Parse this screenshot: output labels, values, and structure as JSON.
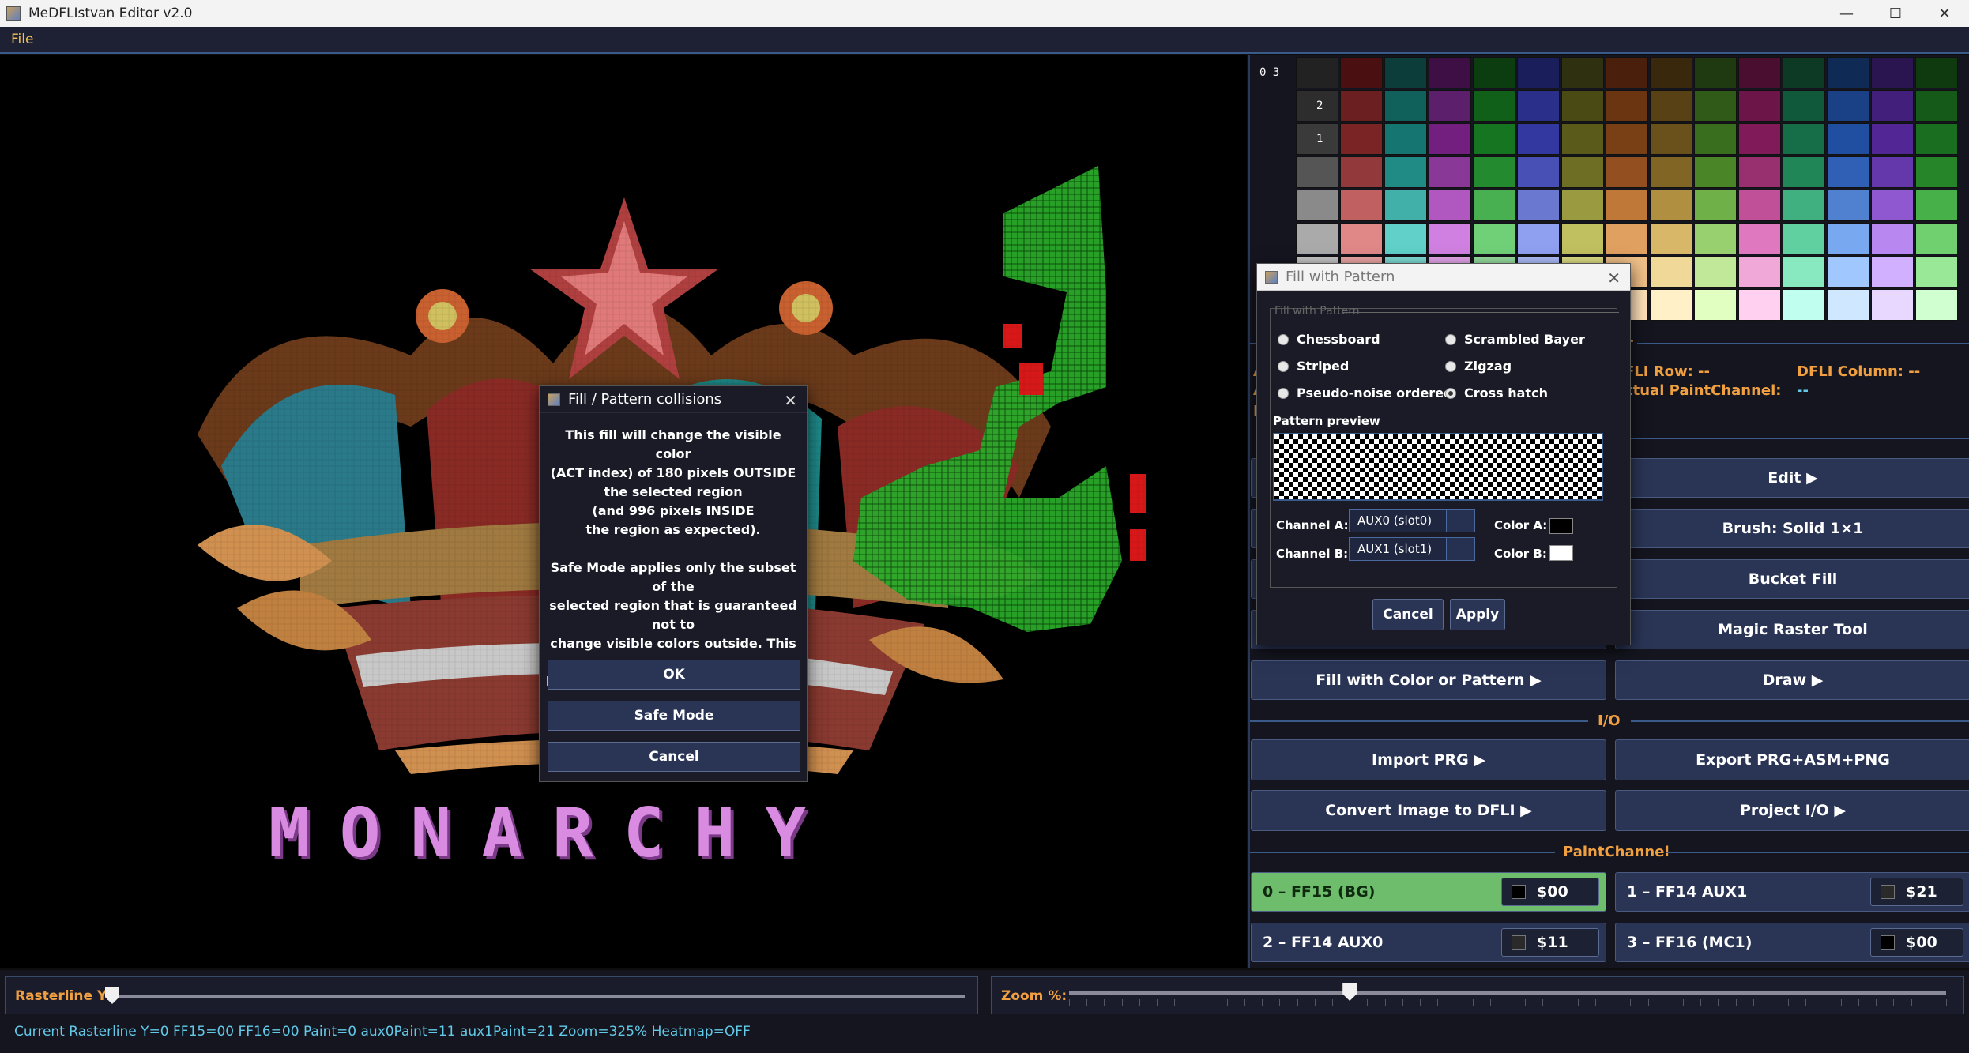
{
  "window": {
    "title": "MeDFLIstvan Editor v2.0",
    "minimize": "—",
    "maximize": "☐",
    "close": "✕"
  },
  "menu": {
    "file": "File"
  },
  "canvas": {
    "logo_text": "MONARCHY"
  },
  "palette": {
    "header_label": "0 3",
    "row_labels": [
      "2",
      "1"
    ],
    "colors": [
      [
        "#222222",
        "#4a0f10",
        "#0c3d3a",
        "#3d0f45",
        "#0b3d10",
        "#1a1f5c",
        "#2e3010",
        "#4a200c",
        "#3a280c",
        "#1f3a10",
        "#4a0f30",
        "#0c3a25",
        "#0f2a55",
        "#2a1550",
        "#0f3a10"
      ],
      [
        "#2d2d2d",
        "#6b1f20",
        "#10605c",
        "#5c1f6b",
        "#10601a",
        "#2a308a",
        "#4a4a15",
        "#6b3512",
        "#584215",
        "#305a18",
        "#6b1548",
        "#10593a",
        "#1a4085",
        "#421f7a",
        "#155a18"
      ],
      [
        "#3a3a3a",
        "#7a2425",
        "#157570",
        "#721f80",
        "#157520",
        "#3238a0",
        "#5a5a1a",
        "#7a4015",
        "#6a501a",
        "#3a6e1f",
        "#801a58",
        "#156e48",
        "#204ea0",
        "#522695",
        "#1a6e1f"
      ],
      [
        "#555555",
        "#923a3b",
        "#208a85",
        "#8a3898",
        "#238a30",
        "#4850b5",
        "#6e6e25",
        "#934f1f",
        "#806525",
        "#4a8528",
        "#983070",
        "#208557",
        "#3060b5",
        "#6438aa",
        "#258528"
      ],
      [
        "#8a8a8a",
        "#c06060",
        "#40b0a8",
        "#b058c0",
        "#48b050",
        "#6a78d0",
        "#9a9a40",
        "#c07838",
        "#b09040",
        "#70b048",
        "#c05098",
        "#40b080",
        "#5080d0",
        "#9058d0",
        "#48b048"
      ],
      [
        "#aaaaaa",
        "#e08888",
        "#60d0c8",
        "#d080e0",
        "#70d078",
        "#90a0f0",
        "#c0c060",
        "#e0a060",
        "#d8b868",
        "#98d070",
        "#e078c0",
        "#60d0a0",
        "#78a8f0",
        "#b888f0",
        "#70d070"
      ],
      [
        "#c8c8c8",
        "#f0a8a8",
        "#80e0d8",
        "#e8a8f0",
        "#98e0a0",
        "#b0c0ff",
        "#e0e088",
        "#f0c088",
        "#f0d898",
        "#c0e898",
        "#f0a8d8",
        "#88e8c0",
        "#a0c8ff",
        "#d0b0ff",
        "#98e898"
      ],
      [
        "#e8e8e8",
        "#ffd0d0",
        "#b0f0f0",
        "#f8d0ff",
        "#c8f8c8",
        "#d8e0ff",
        "#f8f8b8",
        "#ffe0b8",
        "#fff0c8",
        "#e0ffc0",
        "#ffd0f0",
        "#c0fff0",
        "#d0e8ff",
        "#e8d8ff",
        "#d0ffd0"
      ]
    ]
  },
  "info": {
    "section_title": "r",
    "row_label": "FLI Row: --",
    "column_label": "DFLI Column: --",
    "channel_label": "ctual PaintChannel:",
    "channel_value": "--",
    "left_a1": "A",
    "left_a2": "A",
    "left_r": "R"
  },
  "tools": {
    "edit": "Edit ▶",
    "brush": "Brush: Solid 1×1",
    "bucket": "Bucket Fill",
    "magic": "Magic Raster Tool",
    "fill": "Fill with Color or Pattern ▶",
    "draw": "Draw ▶"
  },
  "io": {
    "title": "I/O",
    "import_prg": "Import PRG ▶",
    "export": "Export PRG+ASM+PNG",
    "convert": "Convert Image to DFLI ▶",
    "project": "Project I/O ▶"
  },
  "paint_channel": {
    "title": "PaintChannel",
    "channels": [
      {
        "label": "0 – FF15 (BG)",
        "value": "$00",
        "color": "#000000"
      },
      {
        "label": "1 – FF14 AUX1",
        "value": "$21",
        "color": "#2a2a2a"
      },
      {
        "label": "2 – FF14 AUX0",
        "value": "$11",
        "color": "#2a2a2a"
      },
      {
        "label": "3 – FF16 (MC1)",
        "value": "$00",
        "color": "#000000"
      }
    ]
  },
  "bottom": {
    "raster_label": "Rasterline Y:",
    "raster_value": 0,
    "zoom_label": "Zoom %:",
    "zoom_fraction": 0.32,
    "status": "Current Rasterline Y=0  FF15=00  FF16=00  Paint=0  aux0Paint=11  aux1Paint=21  Zoom=325%  Heatmap=OFF"
  },
  "collision_dialog": {
    "title": "Fill / Pattern collisions",
    "close": "✕",
    "message": "This fill will change the visible color\n(ACT index) of 180 pixels OUTSIDE\nthe selected region\n(and 996 pixels INSIDE\nthe region as expected).\n\nSafe Mode applies only the subset of the\nselected region that is guaranteed not to\nchange visible colors outside. This may\nleave some selected pixels unfilled.\n\nChoose an action:",
    "ok": "OK",
    "safe_mode": "Safe Mode",
    "cancel": "Cancel"
  },
  "pattern_dialog": {
    "title": "Fill with Pattern",
    "close": "✕",
    "legend": "Fill with Pattern",
    "options": [
      "Chessboard",
      "Scrambled Bayer",
      "Striped",
      "Zigzag",
      "Pseudo-noise ordered",
      "Cross hatch"
    ],
    "selected": "Cross hatch",
    "preview_label": "Pattern preview",
    "channel_a_label": "Channel A:",
    "channel_a_value": "AUX0 (slot0)",
    "channel_b_label": "Channel B:",
    "channel_b_value": "AUX1 (slot1)",
    "color_a_label": "Color A:",
    "color_a": "#000000",
    "color_b_label": "Color B:",
    "color_b": "#ffffff",
    "cancel": "Cancel",
    "apply": "Apply"
  }
}
